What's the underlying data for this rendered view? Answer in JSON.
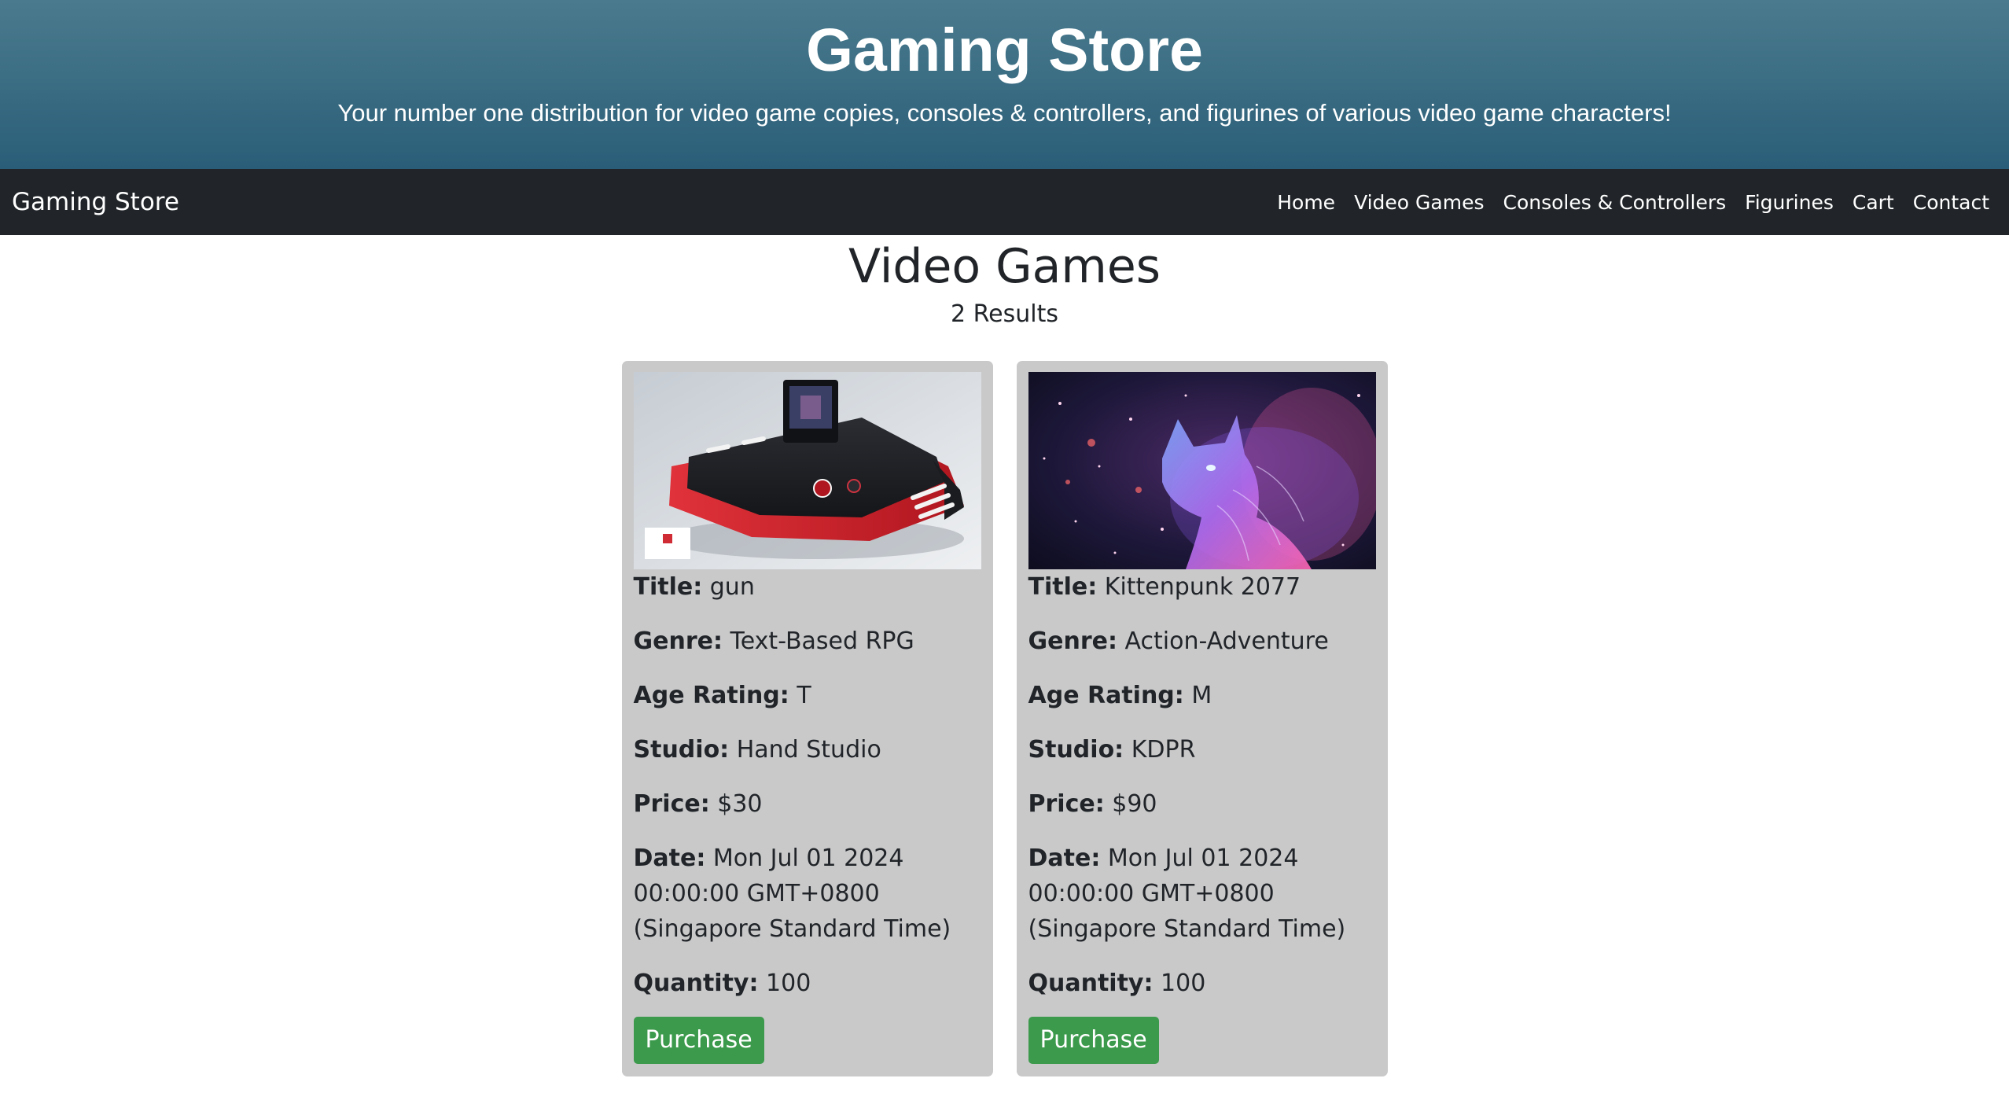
{
  "hero": {
    "title": "Gaming Store",
    "tagline": "Your number one distribution for video game copies, consoles & controllers, and figurines of various video game characters!"
  },
  "navbar": {
    "brand": "Gaming Store",
    "links": [
      "Home",
      "Video Games",
      "Consoles & Controllers",
      "Figurines",
      "Cart",
      "Contact"
    ]
  },
  "page": {
    "title": "Video Games",
    "results": "2 Results"
  },
  "labels": {
    "title": "Title:",
    "genre": "Genre:",
    "age_rating": "Age Rating:",
    "studio": "Studio:",
    "price": "Price:",
    "date": "Date:",
    "quantity": "Quantity:",
    "purchase": "Purchase"
  },
  "products": [
    {
      "title": "gun",
      "genre": "Text-Based RPG",
      "age_rating": "T",
      "studio": "Hand Studio",
      "price": "$30",
      "date": "Mon Jul 01 2024 00:00:00 GMT+0800 (Singapore Standard Time)",
      "quantity": "100",
      "image": "red-black-game-console-image"
    },
    {
      "title": "Kittenpunk 2077",
      "genre": "Action-Adventure",
      "age_rating": "M",
      "studio": "KDPR",
      "price": "$90",
      "date": "Mon Jul 01 2024 00:00:00 GMT+0800 (Singapore Standard Time)",
      "quantity": "100",
      "image": "cosmic-cat-image"
    }
  ],
  "colors": {
    "hero_top": "#4a7a8d",
    "hero_bottom": "#2a5e78",
    "navbar": "#212529",
    "card": "#c9c9ca",
    "purchase_button": "#3c9a4c"
  }
}
